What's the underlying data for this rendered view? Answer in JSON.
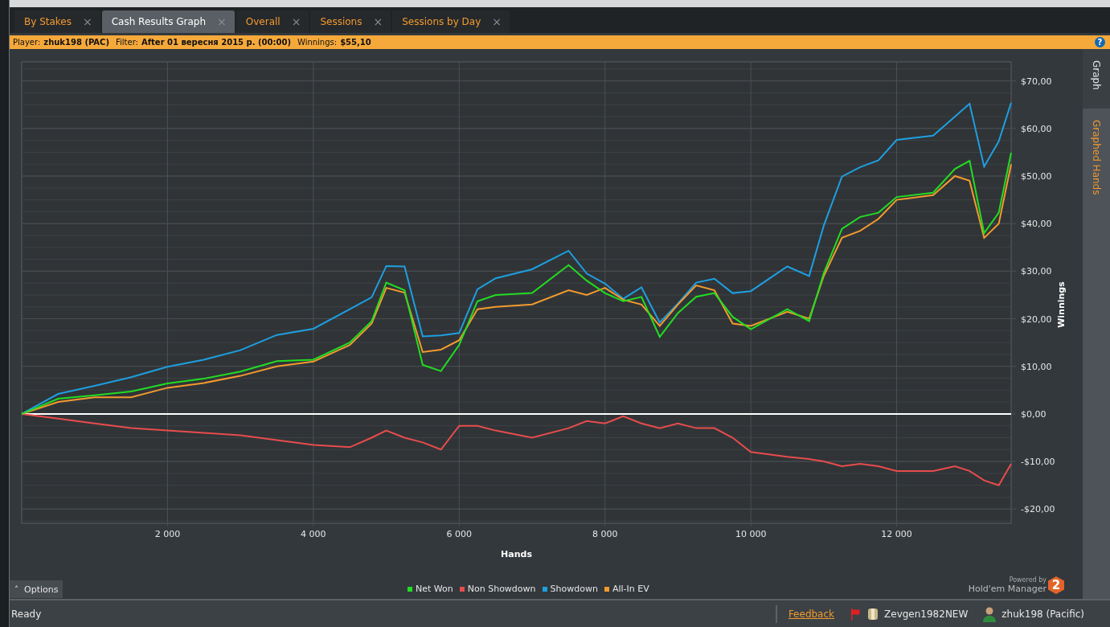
{
  "tabs": [
    {
      "label": "By Stakes",
      "selected": false,
      "close": "×"
    },
    {
      "label": "Cash Results Graph",
      "selected": true,
      "close": "×"
    },
    {
      "label": "Overall",
      "selected": false,
      "close": "×"
    },
    {
      "label": "Sessions",
      "selected": false,
      "close": "×"
    },
    {
      "label": "Sessions by Day",
      "selected": false,
      "close": "×"
    }
  ],
  "info_bar": {
    "items": [
      {
        "label": "Player:",
        "value": "zhuk198 (PAC)"
      },
      {
        "label": "Filter:",
        "value": "After 01 вересня 2015 р. (00:00)"
      },
      {
        "label": "Winnings:",
        "value": "$55,10"
      }
    ],
    "help": "?"
  },
  "side_tabs": [
    {
      "label": "Graph",
      "selected": true
    },
    {
      "label": "Graphed Hands",
      "selected": false
    }
  ],
  "graph": {
    "chart_data": {
      "type": "line",
      "grid": true,
      "xlabel": "Hands",
      "ylabel": "Winnings",
      "x": [
        0,
        500,
        1000,
        1500,
        2000,
        2500,
        3000,
        3500,
        4000,
        4500,
        4800,
        5000,
        5250,
        5500,
        5750,
        6000,
        6250,
        6500,
        7000,
        7500,
        7750,
        8000,
        8250,
        8500,
        8750,
        9000,
        9250,
        9500,
        9750,
        10000,
        10500,
        10800,
        11000,
        11250,
        11500,
        11750,
        12000,
        12500,
        12800,
        13000,
        13200,
        13400,
        13570
      ],
      "series": [
        {
          "name": "Net Won",
          "color": "#22dd22",
          "values": [
            0,
            3.2,
            3.9,
            4.7,
            6.4,
            7.4,
            8.9,
            11.1,
            11.4,
            15,
            19.5,
            27.6,
            26,
            10.3,
            9,
            14.5,
            23.7,
            25,
            25.4,
            31.3,
            28,
            25.4,
            23.7,
            24.6,
            16.2,
            21.2,
            24.6,
            25.4,
            20.4,
            17.8,
            22,
            19.5,
            29.6,
            38.9,
            41.4,
            42.3,
            45.6,
            46.5,
            51.5,
            53.2,
            38,
            42.3,
            54.9
          ]
        },
        {
          "name": "Non Showdown",
          "color": "#e84c4c",
          "values": [
            0,
            -1,
            -2,
            -3,
            -3.5,
            -4,
            -4.5,
            -5.5,
            -6.5,
            -7,
            -5,
            -3.5,
            -5,
            -6,
            -7.5,
            -2.5,
            -2.5,
            -3.5,
            -5,
            -3,
            -1.5,
            -2,
            -0.5,
            -2,
            -3,
            -2,
            -3,
            -3,
            -5,
            -8,
            -9,
            -9.5,
            -10,
            -11,
            -10.5,
            -11,
            -12,
            -12,
            -11,
            -12,
            -14,
            -15,
            -10.5
          ]
        },
        {
          "name": "Showdown",
          "color": "#1e9fe0",
          "values": [
            0,
            4.2,
            5.9,
            7.7,
            9.9,
            11.4,
            13.4,
            16.6,
            17.9,
            22,
            24.5,
            31.1,
            31,
            16.3,
            16.5,
            17,
            26.2,
            28.5,
            30.4,
            34.3,
            29.5,
            27.4,
            24.2,
            26.6,
            19.2,
            23.2,
            27.6,
            28.4,
            25.4,
            25.8,
            31,
            29,
            39.6,
            49.9,
            51.9,
            53.3,
            57.6,
            58.5,
            62.5,
            65.2,
            52,
            57.3,
            65.4
          ]
        },
        {
          "name": "All-In EV",
          "color": "#f39a2e",
          "values": [
            0,
            2.5,
            3.5,
            3.5,
            5.5,
            6.5,
            8,
            10,
            11,
            14.5,
            19,
            26.5,
            25.5,
            13,
            13.5,
            15.5,
            22,
            22.5,
            23,
            26,
            25,
            26.5,
            24,
            23,
            18.5,
            23,
            27,
            26,
            19,
            18.5,
            21.5,
            20,
            29,
            37,
            38.5,
            41,
            45,
            46,
            50,
            49,
            37,
            40,
            52.5
          ]
        }
      ],
      "xlim": [
        0,
        13570
      ],
      "ylim": [
        -23,
        74
      ],
      "xticks": [
        {
          "value": 2000,
          "label": "2 000"
        },
        {
          "value": 4000,
          "label": "4 000"
        },
        {
          "value": 6000,
          "label": "6 000"
        },
        {
          "value": 8000,
          "label": "8 000"
        },
        {
          "value": 10000,
          "label": "10 000"
        },
        {
          "value": 12000,
          "label": "12 000"
        }
      ],
      "yticks": [
        {
          "value": -20,
          "label": "-$20,00"
        },
        {
          "value": -10,
          "label": "-$10,00"
        },
        {
          "value": 0,
          "label": "$0,00"
        },
        {
          "value": 10,
          "label": "$10,00"
        },
        {
          "value": 20,
          "label": "$20,00"
        },
        {
          "value": 30,
          "label": "$30,00"
        },
        {
          "value": 40,
          "label": "$40,00"
        },
        {
          "value": 50,
          "label": "$50,00"
        },
        {
          "value": 60,
          "label": "$60,00"
        },
        {
          "value": 70,
          "label": "$70,00"
        }
      ]
    }
  },
  "options_button": {
    "caret": "˄",
    "label": "Options"
  },
  "branding": {
    "powered_by": "Powered by",
    "product": "Hold'em Manager",
    "badge": "2"
  },
  "status_bar": {
    "status": "Ready",
    "feedback": "Feedback",
    "database": "Zevgen1982NEW",
    "player": "zhuk198 (Pacific)"
  }
}
